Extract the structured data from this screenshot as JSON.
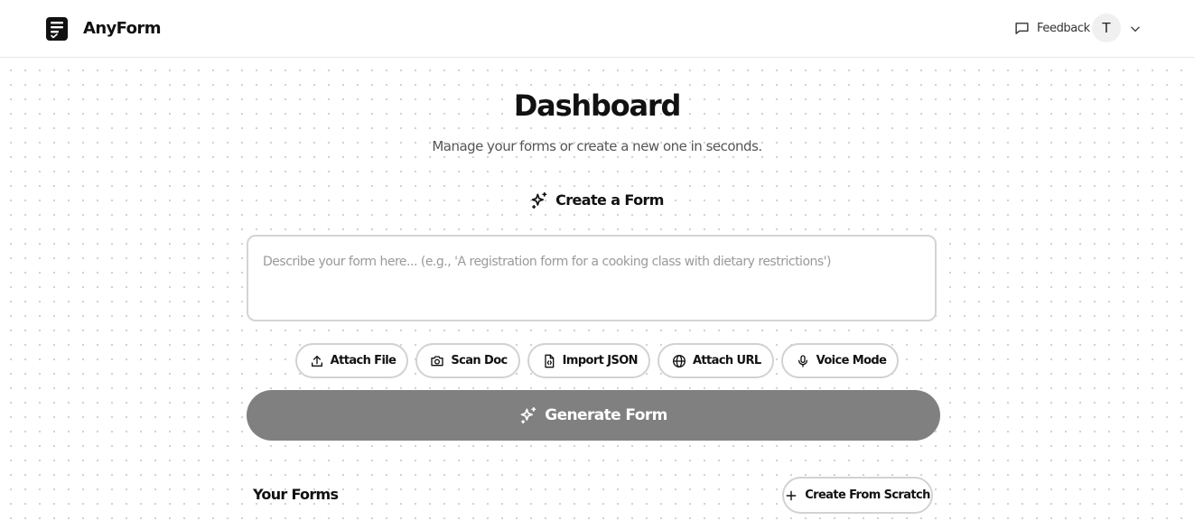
{
  "app": {
    "brand": "AnyForm",
    "logo_icon": "document-check-icon"
  },
  "header": {
    "feedback_label": "Feedback",
    "feedback_icon": "message-square-icon",
    "avatar_initial": "T",
    "menu_icon": "chevron-down-icon"
  },
  "main": {
    "title": "Dashboard",
    "subtitle": "Manage your forms or create a new one in seconds.",
    "create_section": {
      "label": "Create a Form",
      "icon": "sparkles-icon"
    },
    "prompt": {
      "value": "",
      "placeholder": "Describe your form here... (e.g., 'A registration form for a cooking class with dietary restrictions')"
    },
    "attachments": [
      {
        "label": "Attach File",
        "icon": "upload-icon"
      },
      {
        "label": "Scan Doc",
        "icon": "camera-icon"
      },
      {
        "label": "Import JSON",
        "icon": "file-code-icon"
      },
      {
        "label": "Attach URL",
        "icon": "globe-icon"
      },
      {
        "label": "Voice Mode",
        "icon": "microphone-icon"
      }
    ],
    "generate_label": "Generate Form",
    "forms_heading": "Your Forms",
    "create_scratch_label": "Create From Scratch"
  },
  "colors": {
    "accent": "#111111",
    "generate_button": "#808080",
    "border": "#d2d2d2",
    "muted_text": "#555555"
  }
}
